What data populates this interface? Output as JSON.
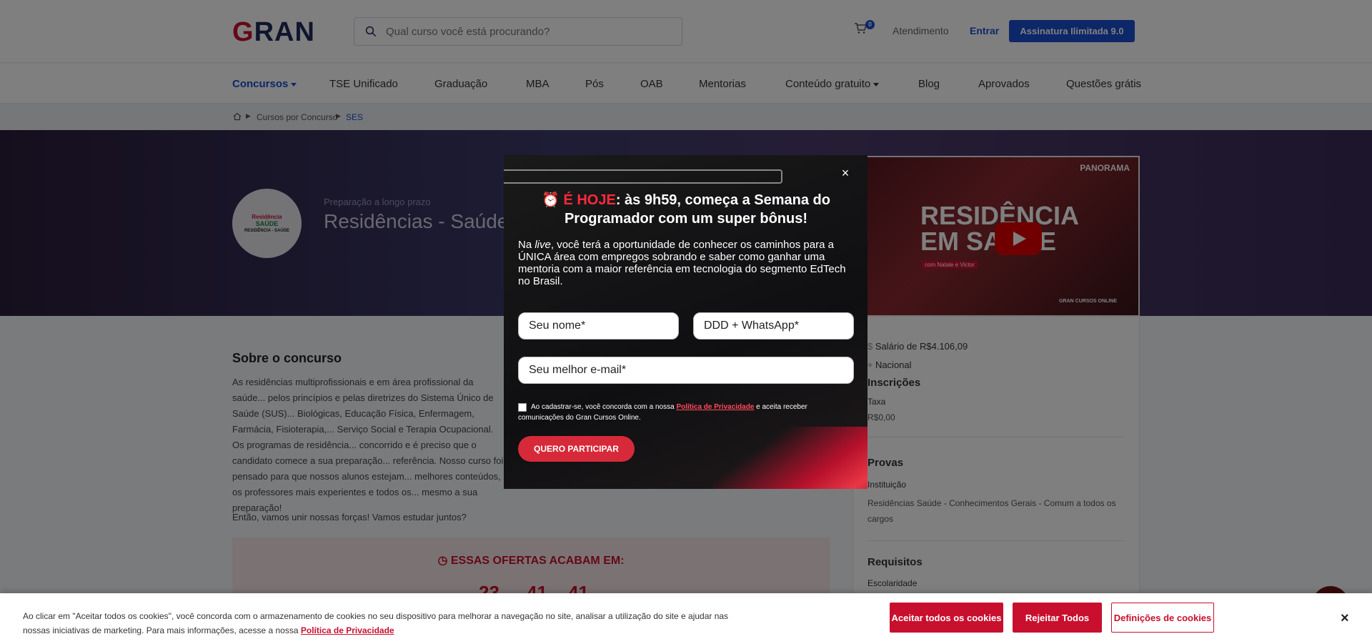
{
  "header": {
    "logo": "GRAN",
    "search_placeholder": "Qual curso você está procurando?",
    "cart_count": "0",
    "atendimento": "Atendimento",
    "entrar": "Entrar",
    "assinatura": "Assinatura  Ilimitada 9.0"
  },
  "nav": [
    {
      "label": "Concursos"
    },
    {
      "label": "TSE Unificado"
    },
    {
      "label": "Graduação"
    },
    {
      "label": "MBA"
    },
    {
      "label": "Pós"
    },
    {
      "label": "OAB"
    },
    {
      "label": "Mentorias"
    },
    {
      "label": "Conteúdo gratuito"
    },
    {
      "label": "Blog"
    },
    {
      "label": "Aprovados"
    },
    {
      "label": "Questões grátis"
    }
  ],
  "breadcrumb": {
    "item1": "Cursos por Concurso",
    "item2": "SES"
  },
  "hero": {
    "subtitle": "Preparação a longo prazo",
    "title": "Residências - Saúde",
    "badge_l1": "Residência",
    "badge_l2": "SAÚDE",
    "badge_l3": "RESIDÊNCIA - SAÚDE"
  },
  "video": {
    "panorama": "PANORAMA",
    "headline1": "RESIDÊNCIA",
    "headline2": "EM SAÚDE",
    "with": "com Natale e Victor",
    "brand": "GRAN CURSOS ONLINE"
  },
  "about": {
    "title": "Sobre o concurso",
    "text": "As residências multiprofissionais e em área profissional da saúde... pelos princípios e pelas diretrizes do Sistema Único de Saúde (SUS)... Biológicas, Educação Física, Enfermagem, Farmácia, Fisioterapia,... Serviço Social e Terapia Ocupacional. Os programas de residência... concorrido e é preciso que o candidato comece a sua preparação... referência. Nosso curso foi pensado para que nossos alunos estejam... melhores conteúdos, os professores mais experientes e todos os... mesmo a sua preparação!",
    "closing": "Então, vamos unir nossas forças! Vamos estudar juntos?"
  },
  "offer": {
    "title": "ESSAS OFERTAS ACABAM EM:",
    "h": "23",
    "m": "41",
    "s": "41"
  },
  "sidebar": {
    "salario": "Salário de R$4.106,09",
    "local": "Nacional",
    "inscricoes": "Inscrições",
    "taxa_label": "Taxa",
    "taxa_value": "R$0,00",
    "provas": "Provas",
    "instituicao_label": "Instituição",
    "instituicao_value": "Residências Saúde - Conhecimentos Gerais - Comum a todos os cargos",
    "requisitos": "Requisitos",
    "escolaridade": "Escolaridade"
  },
  "modal": {
    "emoji": "⏰",
    "headline_red": "É HOJE",
    "headline_rest": ": às 9h59, começa a Semana do Programador com um super bônus!",
    "body_1": "Na ",
    "body_live": "live",
    "body_2": ", você terá a oportunidade de conhecer os caminhos para a ÚNICA área com empregos sobrando e saber como ganhar uma mentoria com a maior referência em tecnologia do segmento EdTech no Brasil.",
    "name_placeholder": "Seu nome*",
    "phone_placeholder": "DDD + WhatsApp*",
    "email_placeholder": "Seu melhor e-mail*",
    "consent_1": "Ao cadastrar-se, você concorda com a nossa ",
    "consent_link": "Política de Privacidade",
    "consent_2": " e aceita receber comunicações do Gran Cursos Online.",
    "cta": "QUERO PARTICIPAR",
    "close": "×"
  },
  "cookie": {
    "text": "Ao clicar em \"Aceitar todos os cookies\", você concorda com o armazenamento de cookies no seu dispositivo para melhorar a navegação no site, analisar a utilização do site e ajudar nas nossas iniciativas de marketing. Para mais informações, acesse a nossa ",
    "link": "Política de Privacidade",
    "accept": "Aceitar todos os cookies",
    "reject": "Rejeitar Todos",
    "settings": "Definições de cookies",
    "close": "×"
  }
}
